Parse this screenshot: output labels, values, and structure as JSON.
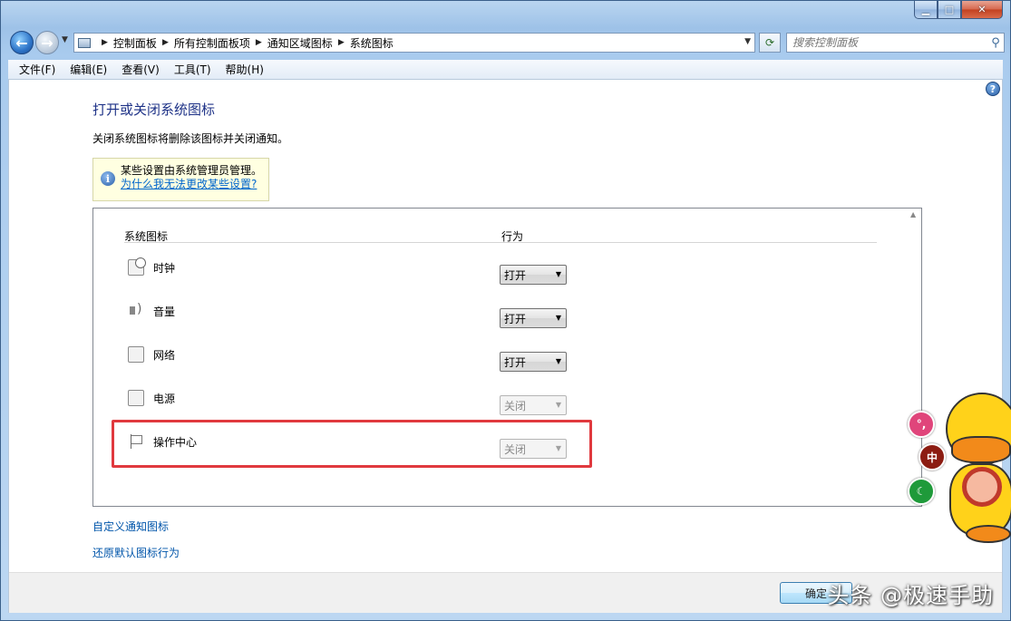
{
  "window": {
    "caption_buttons": [
      "minimize",
      "maximize",
      "close"
    ]
  },
  "nav": {
    "breadcrumbs": [
      "控制面板",
      "所有控制面板项",
      "通知区域图标",
      "系统图标"
    ],
    "search_placeholder": "搜索控制面板"
  },
  "menu": [
    "文件(F)",
    "编辑(E)",
    "查看(V)",
    "工具(T)",
    "帮助(H)"
  ],
  "page": {
    "title": "打开或关闭系统图标",
    "description": "关闭系统图标将删除该图标并关闭通知。",
    "info_text": "某些设置由系统管理员管理。",
    "info_link": "为什么我无法更改某些设置?"
  },
  "table": {
    "col_icon": "系统图标",
    "col_behavior": "行为",
    "rows": [
      {
        "label": "时钟",
        "icon": "clock-icon",
        "value": "打开",
        "enabled": true
      },
      {
        "label": "音量",
        "icon": "volume-icon",
        "value": "打开",
        "enabled": true
      },
      {
        "label": "网络",
        "icon": "network-icon",
        "value": "打开",
        "enabled": true
      },
      {
        "label": "电源",
        "icon": "power-icon",
        "value": "关闭",
        "enabled": false
      },
      {
        "label": "操作中心",
        "icon": "flag-icon",
        "value": "关闭",
        "enabled": false
      }
    ]
  },
  "links": {
    "customize": "自定义通知图标",
    "restore": "还原默认图标行为"
  },
  "footer": {
    "ok_label": "确定"
  },
  "overlay": {
    "watermark": "头条 @极速手助",
    "bubbles": [
      "°,",
      "中",
      "☾"
    ]
  },
  "colors": {
    "highlight": "#e0393e",
    "link": "#0055aa",
    "title": "#1e3287"
  }
}
